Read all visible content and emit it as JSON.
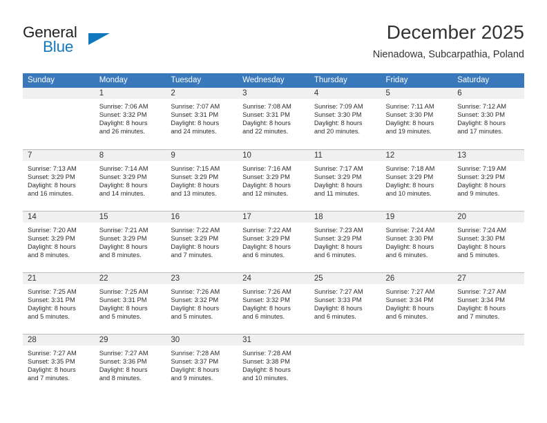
{
  "brand": {
    "name_part1": "General",
    "name_part2": "Blue",
    "triangle_icon": "triangle-icon",
    "color_dark": "#231f20",
    "color_blue": "#1278be"
  },
  "header": {
    "title": "December 2025",
    "location": "Nienadowa, Subcarpathia, Poland"
  },
  "theme": {
    "header_bar": "#3a78bc",
    "daynum_band": "#f0f0f0",
    "grid_line": "#b9b9b9",
    "text": "#2b2b2b"
  },
  "weekdays": [
    "Sunday",
    "Monday",
    "Tuesday",
    "Wednesday",
    "Thursday",
    "Friday",
    "Saturday"
  ],
  "weeks": [
    [
      {
        "day": "",
        "sunrise": "",
        "sunset": "",
        "daylight_line1": "",
        "daylight_line2": ""
      },
      {
        "day": "1",
        "sunrise": "Sunrise: 7:06 AM",
        "sunset": "Sunset: 3:32 PM",
        "daylight_line1": "Daylight: 8 hours",
        "daylight_line2": "and 26 minutes."
      },
      {
        "day": "2",
        "sunrise": "Sunrise: 7:07 AM",
        "sunset": "Sunset: 3:31 PM",
        "daylight_line1": "Daylight: 8 hours",
        "daylight_line2": "and 24 minutes."
      },
      {
        "day": "3",
        "sunrise": "Sunrise: 7:08 AM",
        "sunset": "Sunset: 3:31 PM",
        "daylight_line1": "Daylight: 8 hours",
        "daylight_line2": "and 22 minutes."
      },
      {
        "day": "4",
        "sunrise": "Sunrise: 7:09 AM",
        "sunset": "Sunset: 3:30 PM",
        "daylight_line1": "Daylight: 8 hours",
        "daylight_line2": "and 20 minutes."
      },
      {
        "day": "5",
        "sunrise": "Sunrise: 7:11 AM",
        "sunset": "Sunset: 3:30 PM",
        "daylight_line1": "Daylight: 8 hours",
        "daylight_line2": "and 19 minutes."
      },
      {
        "day": "6",
        "sunrise": "Sunrise: 7:12 AM",
        "sunset": "Sunset: 3:30 PM",
        "daylight_line1": "Daylight: 8 hours",
        "daylight_line2": "and 17 minutes."
      }
    ],
    [
      {
        "day": "7",
        "sunrise": "Sunrise: 7:13 AM",
        "sunset": "Sunset: 3:29 PM",
        "daylight_line1": "Daylight: 8 hours",
        "daylight_line2": "and 16 minutes."
      },
      {
        "day": "8",
        "sunrise": "Sunrise: 7:14 AM",
        "sunset": "Sunset: 3:29 PM",
        "daylight_line1": "Daylight: 8 hours",
        "daylight_line2": "and 14 minutes."
      },
      {
        "day": "9",
        "sunrise": "Sunrise: 7:15 AM",
        "sunset": "Sunset: 3:29 PM",
        "daylight_line1": "Daylight: 8 hours",
        "daylight_line2": "and 13 minutes."
      },
      {
        "day": "10",
        "sunrise": "Sunrise: 7:16 AM",
        "sunset": "Sunset: 3:29 PM",
        "daylight_line1": "Daylight: 8 hours",
        "daylight_line2": "and 12 minutes."
      },
      {
        "day": "11",
        "sunrise": "Sunrise: 7:17 AM",
        "sunset": "Sunset: 3:29 PM",
        "daylight_line1": "Daylight: 8 hours",
        "daylight_line2": "and 11 minutes."
      },
      {
        "day": "12",
        "sunrise": "Sunrise: 7:18 AM",
        "sunset": "Sunset: 3:29 PM",
        "daylight_line1": "Daylight: 8 hours",
        "daylight_line2": "and 10 minutes."
      },
      {
        "day": "13",
        "sunrise": "Sunrise: 7:19 AM",
        "sunset": "Sunset: 3:29 PM",
        "daylight_line1": "Daylight: 8 hours",
        "daylight_line2": "and 9 minutes."
      }
    ],
    [
      {
        "day": "14",
        "sunrise": "Sunrise: 7:20 AM",
        "sunset": "Sunset: 3:29 PM",
        "daylight_line1": "Daylight: 8 hours",
        "daylight_line2": "and 8 minutes."
      },
      {
        "day": "15",
        "sunrise": "Sunrise: 7:21 AM",
        "sunset": "Sunset: 3:29 PM",
        "daylight_line1": "Daylight: 8 hours",
        "daylight_line2": "and 8 minutes."
      },
      {
        "day": "16",
        "sunrise": "Sunrise: 7:22 AM",
        "sunset": "Sunset: 3:29 PM",
        "daylight_line1": "Daylight: 8 hours",
        "daylight_line2": "and 7 minutes."
      },
      {
        "day": "17",
        "sunrise": "Sunrise: 7:22 AM",
        "sunset": "Sunset: 3:29 PM",
        "daylight_line1": "Daylight: 8 hours",
        "daylight_line2": "and 6 minutes."
      },
      {
        "day": "18",
        "sunrise": "Sunrise: 7:23 AM",
        "sunset": "Sunset: 3:29 PM",
        "daylight_line1": "Daylight: 8 hours",
        "daylight_line2": "and 6 minutes."
      },
      {
        "day": "19",
        "sunrise": "Sunrise: 7:24 AM",
        "sunset": "Sunset: 3:30 PM",
        "daylight_line1": "Daylight: 8 hours",
        "daylight_line2": "and 6 minutes."
      },
      {
        "day": "20",
        "sunrise": "Sunrise: 7:24 AM",
        "sunset": "Sunset: 3:30 PM",
        "daylight_line1": "Daylight: 8 hours",
        "daylight_line2": "and 5 minutes."
      }
    ],
    [
      {
        "day": "21",
        "sunrise": "Sunrise: 7:25 AM",
        "sunset": "Sunset: 3:31 PM",
        "daylight_line1": "Daylight: 8 hours",
        "daylight_line2": "and 5 minutes."
      },
      {
        "day": "22",
        "sunrise": "Sunrise: 7:25 AM",
        "sunset": "Sunset: 3:31 PM",
        "daylight_line1": "Daylight: 8 hours",
        "daylight_line2": "and 5 minutes."
      },
      {
        "day": "23",
        "sunrise": "Sunrise: 7:26 AM",
        "sunset": "Sunset: 3:32 PM",
        "daylight_line1": "Daylight: 8 hours",
        "daylight_line2": "and 5 minutes."
      },
      {
        "day": "24",
        "sunrise": "Sunrise: 7:26 AM",
        "sunset": "Sunset: 3:32 PM",
        "daylight_line1": "Daylight: 8 hours",
        "daylight_line2": "and 6 minutes."
      },
      {
        "day": "25",
        "sunrise": "Sunrise: 7:27 AM",
        "sunset": "Sunset: 3:33 PM",
        "daylight_line1": "Daylight: 8 hours",
        "daylight_line2": "and 6 minutes."
      },
      {
        "day": "26",
        "sunrise": "Sunrise: 7:27 AM",
        "sunset": "Sunset: 3:34 PM",
        "daylight_line1": "Daylight: 8 hours",
        "daylight_line2": "and 6 minutes."
      },
      {
        "day": "27",
        "sunrise": "Sunrise: 7:27 AM",
        "sunset": "Sunset: 3:34 PM",
        "daylight_line1": "Daylight: 8 hours",
        "daylight_line2": "and 7 minutes."
      }
    ],
    [
      {
        "day": "28",
        "sunrise": "Sunrise: 7:27 AM",
        "sunset": "Sunset: 3:35 PM",
        "daylight_line1": "Daylight: 8 hours",
        "daylight_line2": "and 7 minutes."
      },
      {
        "day": "29",
        "sunrise": "Sunrise: 7:27 AM",
        "sunset": "Sunset: 3:36 PM",
        "daylight_line1": "Daylight: 8 hours",
        "daylight_line2": "and 8 minutes."
      },
      {
        "day": "30",
        "sunrise": "Sunrise: 7:28 AM",
        "sunset": "Sunset: 3:37 PM",
        "daylight_line1": "Daylight: 8 hours",
        "daylight_line2": "and 9 minutes."
      },
      {
        "day": "31",
        "sunrise": "Sunrise: 7:28 AM",
        "sunset": "Sunset: 3:38 PM",
        "daylight_line1": "Daylight: 8 hours",
        "daylight_line2": "and 10 minutes."
      },
      {
        "day": "",
        "sunrise": "",
        "sunset": "",
        "daylight_line1": "",
        "daylight_line2": ""
      },
      {
        "day": "",
        "sunrise": "",
        "sunset": "",
        "daylight_line1": "",
        "daylight_line2": ""
      },
      {
        "day": "",
        "sunrise": "",
        "sunset": "",
        "daylight_line1": "",
        "daylight_line2": ""
      }
    ]
  ]
}
